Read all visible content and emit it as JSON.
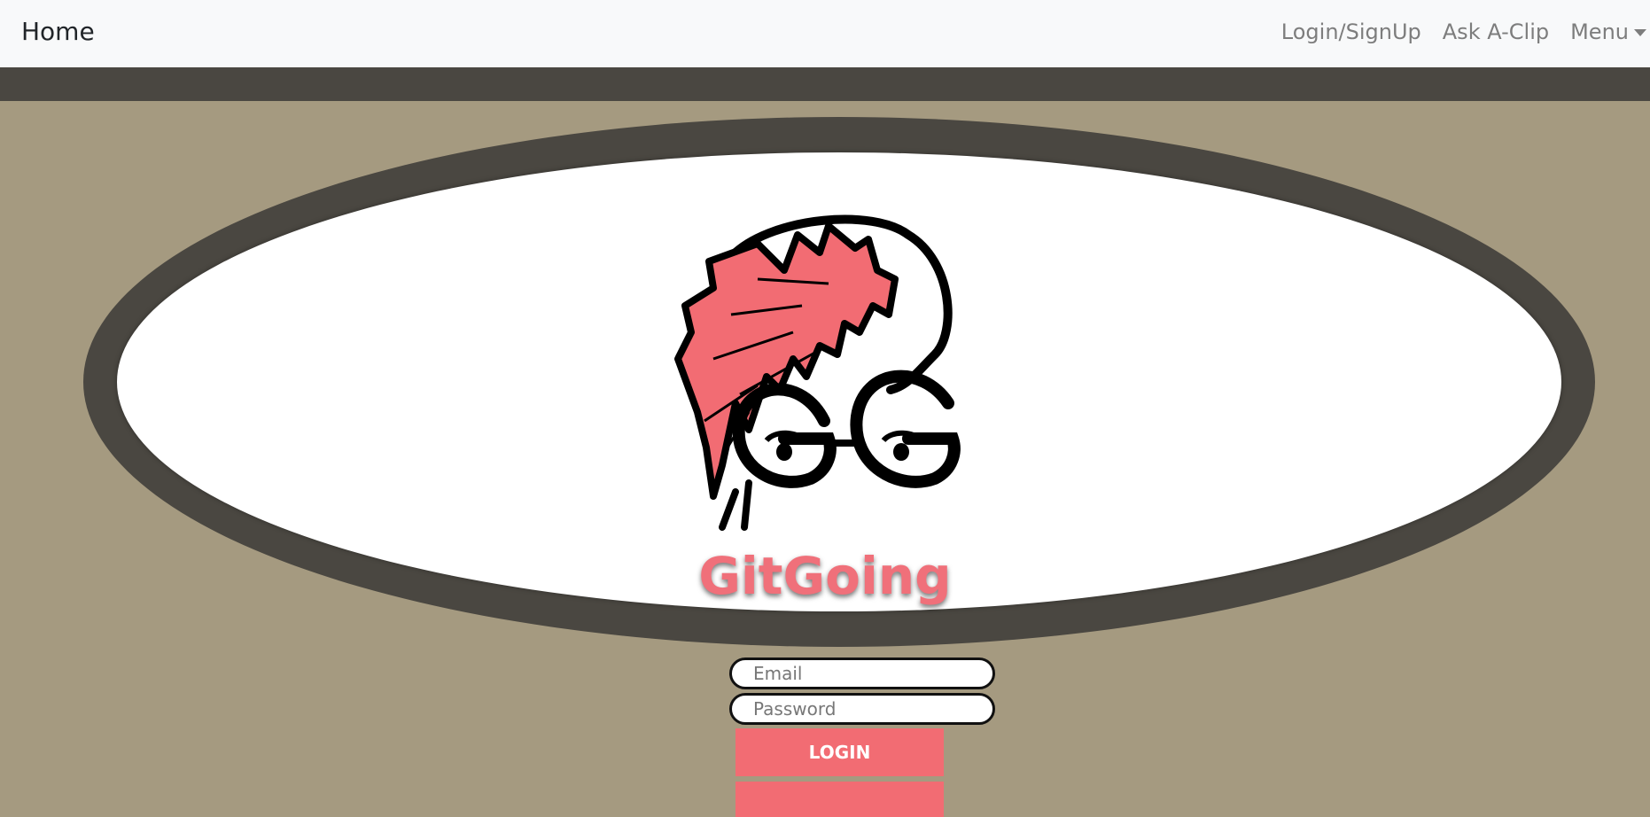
{
  "navbar": {
    "brand": "Home",
    "links": [
      "Login/SignUp",
      "Ask A-Clip",
      "Menu"
    ]
  },
  "logo": {
    "icon": "gitgoing-mascot-logo",
    "initials": "GG"
  },
  "brand_title": "GitGoing",
  "login_form": {
    "email_placeholder": "Email",
    "password_placeholder": "Password",
    "login_label": "LOGIN"
  },
  "colors": {
    "accent": "#f26c73",
    "background": "#a59a80",
    "dark": "#4a4741",
    "navbar": "#f8f9fa"
  }
}
